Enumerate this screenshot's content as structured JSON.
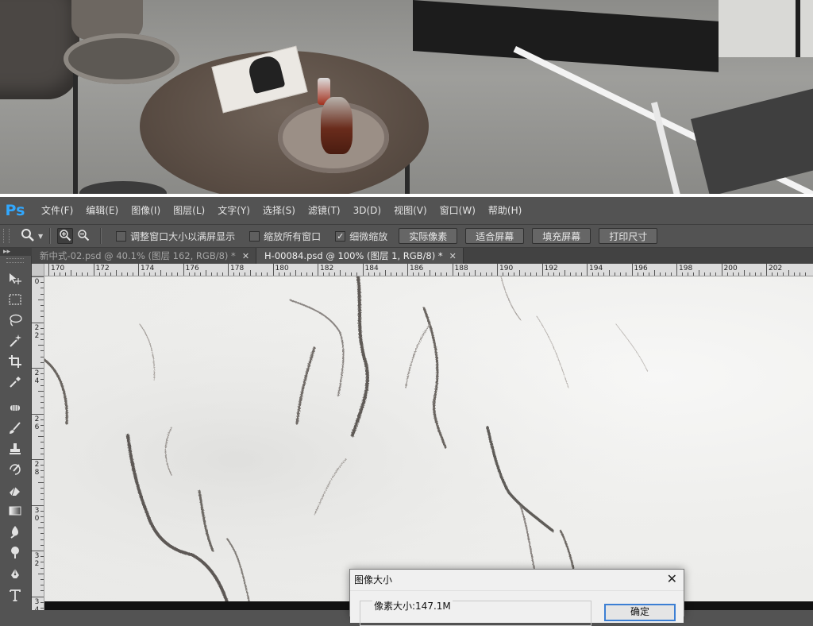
{
  "app": {
    "logo": "Ps"
  },
  "menu": {
    "items": [
      "文件(F)",
      "编辑(E)",
      "图像(I)",
      "图层(L)",
      "文字(Y)",
      "选择(S)",
      "滤镜(T)",
      "3D(D)",
      "视图(V)",
      "窗口(W)",
      "帮助(H)"
    ]
  },
  "options": {
    "tool_icon": "zoom-icon",
    "zoom_in_icon": "zoom-in-icon",
    "zoom_out_icon": "zoom-out-icon",
    "checkboxes": [
      {
        "label": "调整窗口大小以满屏显示",
        "checked": false
      },
      {
        "label": "缩放所有窗口",
        "checked": false
      },
      {
        "label": "细微缩放",
        "checked": true
      }
    ],
    "buttons": [
      "实际像素",
      "适合屏幕",
      "填充屏幕",
      "打印尺寸"
    ]
  },
  "tabs": [
    {
      "label": "新中式-02.psd @ 40.1% (图层 162, RGB/8) *",
      "active": false
    },
    {
      "label": "H-00084.psd @ 100% (图层 1, RGB/8) *",
      "active": true
    }
  ],
  "toolbar": {
    "collapse_glyph": "▸▸",
    "tools": [
      "move-tool-icon",
      "marquee-tool-icon",
      "lasso-tool-icon",
      "magic-wand-tool-icon",
      "crop-tool-icon",
      "eyedropper-tool-icon",
      "healing-brush-tool-icon",
      "brush-tool-icon",
      "clone-stamp-tool-icon",
      "history-brush-tool-icon",
      "eraser-tool-icon",
      "gradient-tool-icon",
      "blur-tool-icon",
      "dodge-tool-icon",
      "pen-tool-icon",
      "type-tool-icon"
    ]
  },
  "ruler": {
    "top_labels": [
      "170",
      "172",
      "174",
      "176",
      "178",
      "180",
      "182",
      "184",
      "186",
      "188",
      "190",
      "192",
      "194",
      "196",
      "198",
      "200",
      "202"
    ],
    "left_labels": [
      "0",
      "2\n2",
      "2\n4",
      "2\n6",
      "2\n8",
      "3\n0",
      "3\n2",
      "3\n4"
    ]
  },
  "dialog": {
    "title": "图像大小",
    "close_glyph": "✕",
    "pixel_size_label": "像素大小:147.1M",
    "ok_label": "确定"
  },
  "colors": {
    "ps_blue": "#31a8ff",
    "panel_bg": "#535353",
    "dialog_focus": "#3c7fd4"
  }
}
